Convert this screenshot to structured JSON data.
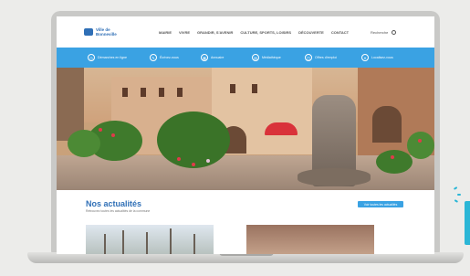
{
  "site": {
    "logo_text": "Ville de\nBonneville"
  },
  "nav": {
    "items": [
      "MAIRIE",
      "VIVRE",
      "GRANDIR, S'AVENIR",
      "CULTURE, SPORTS, LOISIRS",
      "DÉCOUVERTE",
      "CONTACT"
    ],
    "search_label": "Recherche"
  },
  "quick_links": [
    {
      "icon": "clock-icon",
      "label": "Démarches en ligne"
    },
    {
      "icon": "pen-icon",
      "label": "Écrivez-nous"
    },
    {
      "icon": "calendar-icon",
      "label": "Annuaire"
    },
    {
      "icon": "grid-icon",
      "label": "Médiathèque"
    },
    {
      "icon": "briefcase-icon",
      "label": "Offres d'emploi"
    },
    {
      "icon": "location-icon",
      "label": "Localisez-vous"
    }
  ],
  "news": {
    "title": "Nos actualités",
    "subtitle": "Retrouvez toutes les actualités de la commune",
    "button_label": "Voir toutes les actualités"
  },
  "colors": {
    "brand_blue": "#3aa2e3",
    "title_blue": "#2f6fb6"
  }
}
